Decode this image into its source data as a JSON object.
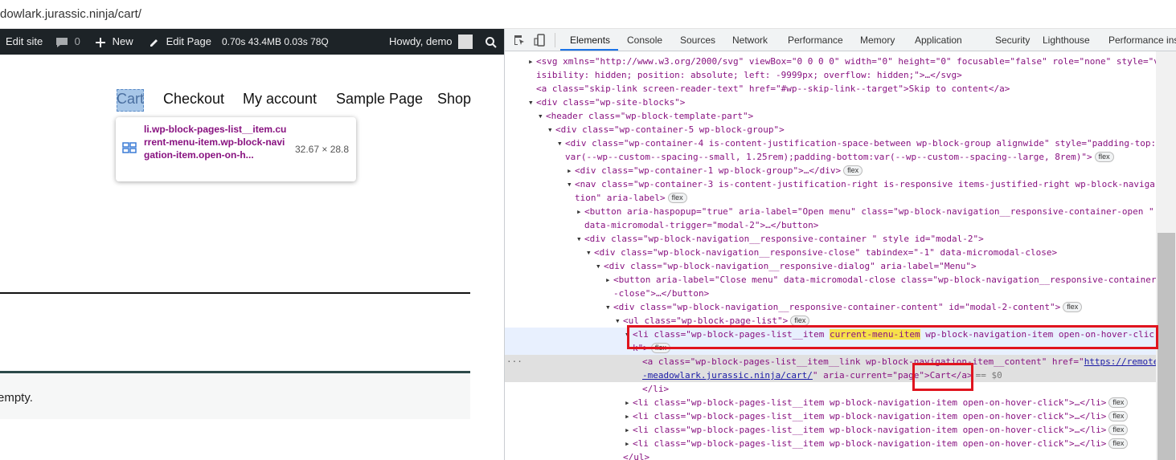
{
  "browser": {
    "url": "dowlark.jurassic.ninja/cart/"
  },
  "adminbar": {
    "edit_site": "Edit site",
    "comments": "0",
    "new": "New",
    "edit_page": "Edit Page",
    "stats": "0.70s  43.4MB  0.03s  78Q",
    "howdy": "Howdy, demo"
  },
  "site": {
    "nav": [
      "Cart",
      "Checkout",
      "My account",
      "Sample Page",
      "Shop"
    ],
    "tooltip": {
      "selector": "li.wp-block-pages-list__item.current-menu-item.wp-block-navigation-item.open-on-h...",
      "size": "32.67 × 28.8"
    },
    "notice": "empty."
  },
  "devtools": {
    "tabs": [
      "Elements",
      "Console",
      "Sources",
      "Network",
      "Performance",
      "Memory",
      "Application",
      "Security",
      "Lighthouse",
      "Performance ins"
    ],
    "active_tab": "Elements",
    "badge": "flex",
    "dollar0": "== $0",
    "lines": [
      "<svg xmlns=\"http://www.w3.org/2000/svg\" viewBox=\"0 0 0 0\" width=\"0\" height=\"0\" focusable=\"false\" role=\"none\" style=\"v",
      "isibility: hidden; position: absolute; left: -9999px; overflow: hidden;\">…</svg>",
      "<a class=\"skip-link screen-reader-text\" href=\"#wp--skip-link--target\">Skip to content</a>",
      "<div class=\"wp-site-blocks\">",
      "<header class=\"wp-block-template-part\">",
      "<div class=\"wp-container-5 wp-block-group\">",
      "<div class=\"wp-container-4 is-content-justification-space-between wp-block-group alignwide\" style=\"padding-top:",
      "var(--wp--custom--spacing--small, 1.25rem);padding-bottom:var(--wp--custom--spacing--large, 8rem)\">",
      "<div class=\"wp-container-1 wp-block-group\">…</div>",
      "<nav class=\"wp-container-3 is-content-justification-right is-responsive items-justified-right wp-block-naviga",
      "tion\" aria-label>",
      "<button aria-haspopup=\"true\" aria-label=\"Open menu\" class=\"wp-block-navigation__responsive-container-open \"",
      "data-micromodal-trigger=\"modal-2\">…</button>",
      "<div class=\"wp-block-navigation__responsive-container  \" style id=\"modal-2\">",
      "<div class=\"wp-block-navigation__responsive-close\" tabindex=\"-1\" data-micromodal-close>",
      "<div class=\"wp-block-navigation__responsive-dialog\" aria-label=\"Menu\">",
      "<button aria-label=\"Close menu\" data-micromodal-close class=\"wp-block-navigation__responsive-container",
      "-close\">…</button>",
      "<div class=\"wp-block-navigation__responsive-container-content\" id=\"modal-2-content\">",
      "<ul class=\"wp-block-page-list\">",
      "<li class=\"wp-block-pages-list__item ",
      "current-menu-item",
      " wp-block-navigation-item open-on-hover-clic",
      "k\">",
      "<a class=\"wp-block-pages-list__item__link wp-block-navigation-item__content\" href=\"",
      "https://remote",
      "-meadowlark.jurassic.ninja/cart/",
      "\" aria-current=\"page\">Cart</a>",
      "</li>",
      "<li class=\"wp-block-pages-list__item wp-block-navigation-item open-on-hover-click\">…</li>",
      "<li class=\"wp-block-pages-list__item wp-block-navigation-item open-on-hover-click\">…</li>",
      "<li class=\"wp-block-pages-list__item wp-block-navigation-item open-on-hover-click\">…</li>",
      "<li class=\"wp-block-pages-list__item wp-block-navigation-item open-on-hover-click\">…</li>",
      "</ul>"
    ]
  }
}
